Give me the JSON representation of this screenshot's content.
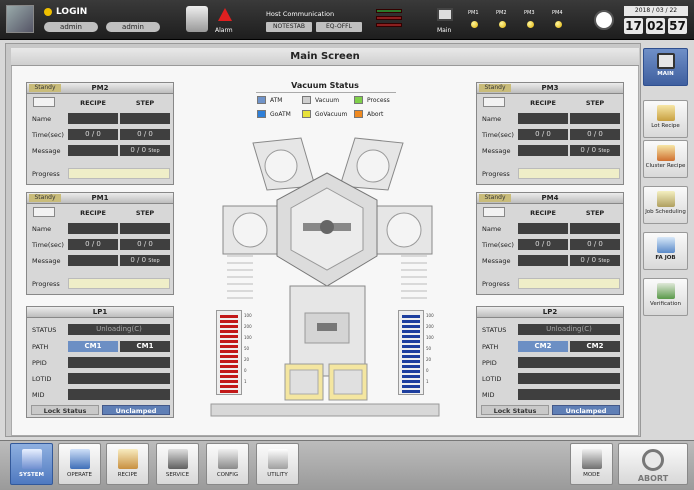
{
  "header": {
    "login_title": "LOGIN",
    "user1": "admin",
    "user2": "admin",
    "alarm_label": "Alarm",
    "host_comm_title": "Host Communication",
    "host_btn1": "NOTESTAB",
    "host_btn2": "EQ-OFFL",
    "main_label": "Main",
    "pm_leds": [
      "PM1",
      "PM2",
      "PM3",
      "PM4"
    ],
    "date": "2018 / 03 / 22",
    "time": {
      "h": "17",
      "m": "02",
      "s": "57"
    }
  },
  "main": {
    "title": "Main Screen"
  },
  "vacuum_status": {
    "title": "Vacuum Status",
    "items": [
      {
        "label": "ATM",
        "color": "#6f93c9"
      },
      {
        "label": "Vacuum",
        "color": "#cfcfcf"
      },
      {
        "label": "Process",
        "color": "#7fd04a"
      },
      {
        "label": "GoATM",
        "color": "#2f7fd8"
      },
      {
        "label": "GoVacuum",
        "color": "#e8e23a"
      },
      {
        "label": "Abort",
        "color": "#f08a20"
      }
    ]
  },
  "pm_common": {
    "status": "Standy",
    "recipe_header": "RECIPE",
    "step_header": "STEP",
    "name_label": "Name",
    "time_label": "Time(sec)",
    "message_label": "Message",
    "progress_label": "Progress",
    "time_val1": "0 / 0",
    "time_val2": "0 / 0",
    "step_val": "0 / 0",
    "step_suffix": "Step"
  },
  "pms": {
    "pm2": {
      "title": "PM2"
    },
    "pm1": {
      "title": "PM1"
    },
    "pm3": {
      "title": "PM3"
    },
    "pm4": {
      "title": "PM4"
    }
  },
  "lp_common": {
    "status_label": "STATUS",
    "path_label": "PATH",
    "ppid_label": "PPID",
    "lotid_label": "LOTID",
    "mid_label": "MID",
    "status_val": "Unloading(C)",
    "lock_status": "Lock Status",
    "unclamped": "Unclamped",
    "path_right": "CM1"
  },
  "lps": {
    "lp1": {
      "title": "LP1",
      "path_sel": "CM1",
      "path_right": "CM1"
    },
    "lp2": {
      "title": "LP2",
      "path_sel": "CM2",
      "path_right": "CM2"
    }
  },
  "gauges": {
    "left_ticks": [
      "100",
      "200",
      "100",
      "50",
      "20",
      "0",
      "1"
    ],
    "right_ticks": [
      "100",
      "200",
      "100",
      "50",
      "20",
      "0",
      "1"
    ],
    "left_color": "#c21818",
    "right_color": "#1d3e9e"
  },
  "sidebar": {
    "items": [
      {
        "label": "MAIN"
      },
      {
        "label": "Lot Recipe"
      },
      {
        "label": "Cluster Recipe"
      },
      {
        "label": "Job Scheduling"
      },
      {
        "label": "FA JOB"
      },
      {
        "label": "Verification"
      }
    ]
  },
  "bottom": {
    "items": [
      {
        "label": "SYSTEM"
      },
      {
        "label": "OPERATE"
      },
      {
        "label": "RECIPE"
      },
      {
        "label": "SERVICE"
      },
      {
        "label": "CONFIG"
      },
      {
        "label": "UTILITY"
      }
    ],
    "mode": "MODE",
    "abort": "ABORT"
  }
}
